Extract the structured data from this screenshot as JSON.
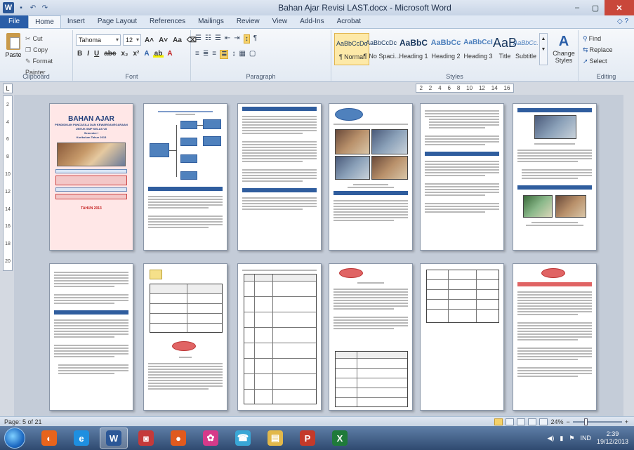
{
  "window": {
    "title": "Bahan Ajar Revisi LAST.docx - Microsoft Word",
    "minimize": "–",
    "maximize": "▢",
    "close": "✕"
  },
  "qat": {
    "app_icon": "W",
    "save": "▪",
    "undo": "↶",
    "redo": "↷"
  },
  "tabs": [
    {
      "label": "File"
    },
    {
      "label": "Home"
    },
    {
      "label": "Insert"
    },
    {
      "label": "Page Layout"
    },
    {
      "label": "References"
    },
    {
      "label": "Mailings"
    },
    {
      "label": "Review"
    },
    {
      "label": "View"
    },
    {
      "label": "Add-Ins"
    },
    {
      "label": "Acrobat"
    }
  ],
  "help_icon": "◇ ?",
  "clipboard": {
    "paste": "Paste",
    "cut": "Cut",
    "copy": "Copy",
    "format_painter": "Format Painter",
    "group": "Clipboard"
  },
  "font": {
    "name": "Tahoma",
    "size": "12",
    "grow": "A˄",
    "shrink": "A˅",
    "case": "Aa",
    "clear": "⌫",
    "bold": "B",
    "italic": "I",
    "underline": "U",
    "strike": "abc",
    "sub": "x₂",
    "sup": "x²",
    "effects": "A",
    "highlight": "ab",
    "color": "A",
    "group": "Font"
  },
  "paragraph": {
    "row1": [
      "☰",
      "☷",
      "☰",
      "⇤",
      "⇥",
      "↕",
      "¶"
    ],
    "row2": [
      "≡",
      "≣",
      "≡",
      "≣",
      "↨",
      "▦",
      "▢"
    ],
    "group": "Paragraph"
  },
  "styles": {
    "items": [
      {
        "sample": "AaBbCcDc",
        "name": "¶ Normal"
      },
      {
        "sample": "AaBbCcDc",
        "name": "¶ No Spaci..."
      },
      {
        "sample": "AaBbC",
        "name": "Heading 1"
      },
      {
        "sample": "AaBbCc",
        "name": "Heading 2"
      },
      {
        "sample": "AaBbCcI",
        "name": "Heading 3"
      },
      {
        "sample": "AaB",
        "name": "Title"
      },
      {
        "sample": "AaBbCc.",
        "name": "Subtitle"
      }
    ],
    "change": "Change Styles",
    "change_glyph": "A",
    "group": "Styles"
  },
  "editing": {
    "find": "Find",
    "replace": "Replace",
    "select": "Select",
    "group": "Editing"
  },
  "ruler": {
    "corner": "L",
    "h_ticks": [
      "2",
      "2",
      "4",
      "6",
      "8",
      "10",
      "12",
      "14",
      "16"
    ],
    "v_ticks": [
      "2",
      "4",
      "6",
      "8",
      "10",
      "12",
      "14",
      "16",
      "18",
      "20"
    ]
  },
  "cover": {
    "title": "BAHAN AJAR",
    "subtitle_lines": [
      "PENDIDIKAN PANCASILA DAN KEWARGANEGARAAN",
      "UNTUK SMP KELAS VII",
      "Semester I",
      "Kurikulum Tahun 2013"
    ],
    "footer": "TAHUN 2013"
  },
  "status": {
    "page": "Page: 5 of 21",
    "zoom": "24%",
    "zoom_out": "−",
    "zoom_in": "+"
  },
  "taskbar": {
    "apps": [
      {
        "glyph": "◐",
        "color": "#e8641c"
      },
      {
        "glyph": "e",
        "color": "#1e8fe0"
      },
      {
        "glyph": "W",
        "color": "#2b5797"
      },
      {
        "glyph": "◙",
        "color": "#c43a3a"
      },
      {
        "glyph": "●",
        "color": "#e05a1e"
      },
      {
        "glyph": "✿",
        "color": "#d63a8a"
      },
      {
        "glyph": "☎",
        "color": "#3aa7d6"
      },
      {
        "glyph": "▤",
        "color": "#e2b84a"
      },
      {
        "glyph": "P",
        "color": "#c43a2a"
      },
      {
        "glyph": "X",
        "color": "#1f7a3a"
      }
    ],
    "lang": "IND",
    "time": "2:39",
    "date": "19/12/2013"
  }
}
